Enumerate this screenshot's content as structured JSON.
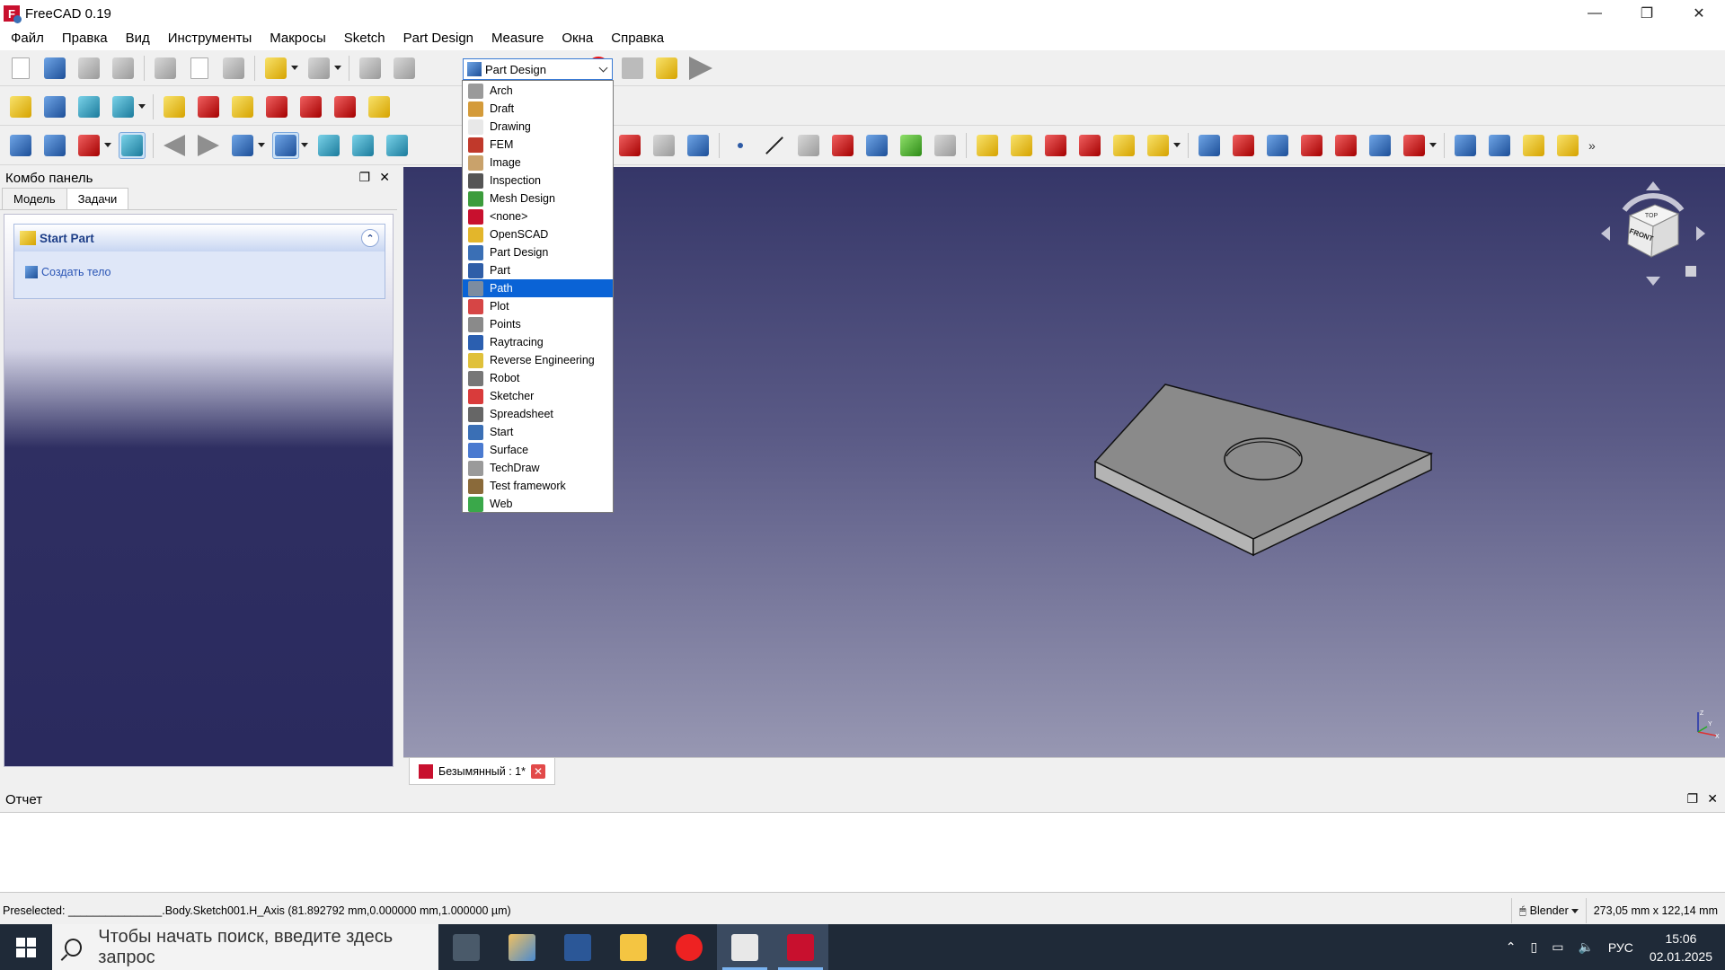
{
  "window": {
    "title": "FreeCAD 0.19",
    "controls": {
      "minimize": "—",
      "restore": "❐",
      "close": "✕"
    }
  },
  "menu": [
    "Файл",
    "Правка",
    "Вид",
    "Инструменты",
    "Макросы",
    "Sketch",
    "Part Design",
    "Measure",
    "Окна",
    "Справка"
  ],
  "workbench_selector": {
    "value": "Part Design",
    "options": [
      {
        "label": "Arch",
        "color": "#9a9a9a"
      },
      {
        "label": "Draft",
        "color": "#d49b3a"
      },
      {
        "label": "Drawing",
        "color": "#e8e8e8"
      },
      {
        "label": "FEM",
        "color": "#c0392b"
      },
      {
        "label": "Image",
        "color": "#c9a26b"
      },
      {
        "label": "Inspection",
        "color": "#555555"
      },
      {
        "label": "Mesh Design",
        "color": "#3c9c3c"
      },
      {
        "label": "<none>",
        "color": "#c8102e"
      },
      {
        "label": "OpenSCAD",
        "color": "#e3b62b"
      },
      {
        "label": "Part Design",
        "color": "#3a6fb5"
      },
      {
        "label": "Part",
        "color": "#2f5ea8"
      },
      {
        "label": "Path",
        "color": "#7c8ca0"
      },
      {
        "label": "Plot",
        "color": "#d64545"
      },
      {
        "label": "Points",
        "color": "#8a8a8a"
      },
      {
        "label": "Raytracing",
        "color": "#2b5fb0"
      },
      {
        "label": "Reverse Engineering",
        "color": "#e0c13a"
      },
      {
        "label": "Robot",
        "color": "#777777"
      },
      {
        "label": "Sketcher",
        "color": "#d93b3b"
      },
      {
        "label": "Spreadsheet",
        "color": "#666666"
      },
      {
        "label": "Start",
        "color": "#3a6fb5"
      },
      {
        "label": "Surface",
        "color": "#4a7ad0"
      },
      {
        "label": "TechDraw",
        "color": "#9a9a9a"
      },
      {
        "label": "Test framework",
        "color": "#8a6a3a"
      },
      {
        "label": "Web",
        "color": "#3aa84a"
      }
    ],
    "highlighted": "Path"
  },
  "combo_panel": {
    "title": "Комбо панель",
    "tabs": [
      "Модель",
      "Задачи"
    ],
    "active_tab": "Задачи",
    "task": {
      "title": "Start Part",
      "action": "Создать тело"
    }
  },
  "navcube": {
    "top_label": "TOP",
    "front_label": "FRONT"
  },
  "axes": {
    "x": "X",
    "y": "Y",
    "z": "Z"
  },
  "document_tab": {
    "label": "Безымянный : 1*"
  },
  "report": {
    "title": "Отчет"
  },
  "status": {
    "preselected": "Preselected: _______________.Body.Sketch001.H_Axis (81.892792 mm,0.000000 mm,1.000000 µm)",
    "nav_style": "Blender",
    "dimensions": "273,05 mm x 122,14 mm"
  },
  "taskbar": {
    "search_placeholder": "Чтобы начать поиск, введите здесь запрос",
    "language": "РУС",
    "time": "15:06",
    "date": "02.01.2025"
  },
  "colors": {
    "accent": "#0a63d6",
    "view_top": "#353668",
    "view_bottom": "#9797b2",
    "taskbar": "#1f2a38"
  }
}
